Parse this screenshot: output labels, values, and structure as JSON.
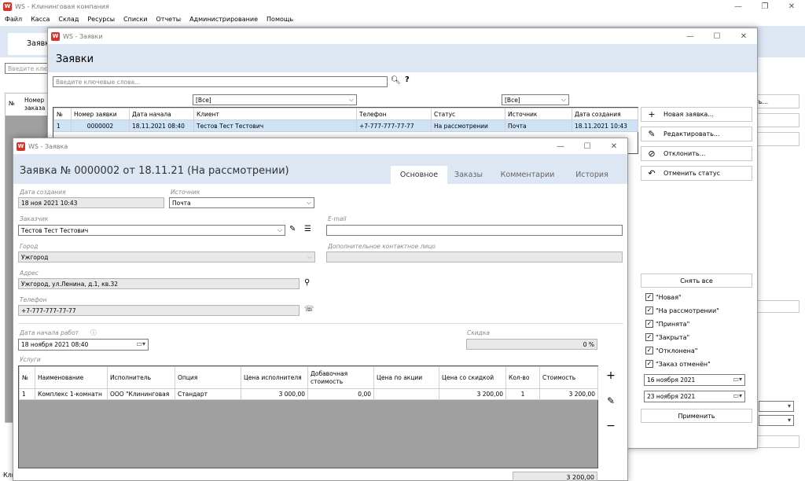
{
  "main": {
    "title": "WS - Клининговая компания",
    "menu": [
      "Файл",
      "Касса",
      "Склад",
      "Ресурсы",
      "Списки",
      "Отчеты",
      "Администрирование",
      "Помощь"
    ],
    "tab_partial": "Заявк",
    "search_partial": "Введите ключ",
    "col_no": "№",
    "col_order_partial": "Номер",
    "col_order_partial2": "заказа",
    "right_btn_frag": "ть...",
    "bottom_frag": "Кли"
  },
  "zayavki": {
    "title": "WS - Заявки",
    "heading": "Заявки",
    "search_placeholder": "Введите ключевые слова...",
    "filter_client": "[Все]",
    "filter_source": "[Все]",
    "columns": [
      "№",
      "Номер заявки",
      "Дата начала",
      "Клиент",
      "Телефон",
      "Статус",
      "Источник",
      "Дата создания"
    ],
    "row": [
      "1",
      "0000002",
      "18.11.2021 08:40",
      "Тестов Тест Тестович",
      "+7-777-777-77-77",
      "На рассмотрении",
      "Почта",
      "18.11.2021 10:43"
    ],
    "actions": [
      {
        "label": "Новая заявка...",
        "icon": "+"
      },
      {
        "label": "Редактировать...",
        "icon": "✎"
      },
      {
        "label": "Отклонить...",
        "icon": "⊘"
      },
      {
        "label": "Отменить статус",
        "icon": "↶"
      }
    ],
    "clear_all": "Снять все",
    "statuses": [
      "\"Новая\"",
      "\"На рассмотрении\"",
      "\"Принята\"",
      "\"Закрыта\"",
      "\"Отклонена\"",
      "\"Заказ отменён\""
    ],
    "date_from": "16 ноября  2021",
    "date_to": "23 ноября  2021",
    "apply": "Применить"
  },
  "zayavka": {
    "title": "WS - Заявка",
    "heading": "Заявка № 0000002 от 18.11.21 (На рассмотрении)",
    "tabs": [
      "Основное",
      "Заказы",
      "Комментарии",
      "История"
    ],
    "labels": {
      "created": "Дата создания",
      "source": "Источник",
      "customer": "Заказчик",
      "email": "E-mail",
      "city": "Город",
      "contact": "Дополнительное контактное лицо",
      "address": "Адрес",
      "phone": "Телефон",
      "start": "Дата начала работ",
      "discount": "Скидка",
      "services": "Услуги"
    },
    "values": {
      "created": "18 ноя 2021 10:43",
      "source": "Почта",
      "customer": "Тестов Тест Тестович",
      "email": "",
      "city": "Ужгород",
      "contact": "",
      "address": "Ужгород, ул.Ленина, д.1, кв.32",
      "phone": "+7-777-777-77-77",
      "start": "18  ноября  2021  08:40",
      "discount": "0 %"
    },
    "svc_columns": [
      "№",
      "Наименование",
      "Исполнитель",
      "Опция",
      "Цена исполнителя",
      "Добавочная стоимость",
      "Цена по акции",
      "Цена со скидкой",
      "Кол-во",
      "Стоимость"
    ],
    "svc_row": [
      "1",
      "Комплекс 1-комнатн",
      "ООО \"Клининговая",
      "Стандарт",
      "3 000,00",
      "0,00",
      "",
      "3 200,00",
      "1",
      "3 200,00"
    ],
    "total": "3 200,00"
  }
}
